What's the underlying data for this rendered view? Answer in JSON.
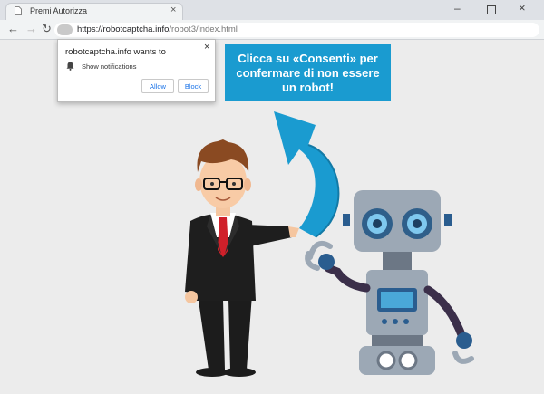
{
  "browser": {
    "tab_title": "Premi Autorizza",
    "tab_close": "×",
    "window_controls": {
      "minimize": "–",
      "close": "×"
    },
    "nav": {
      "back": "←",
      "forward": "→",
      "reload": "↻"
    },
    "url_host": "https://robotcaptcha.info",
    "url_path": "/robot3/index.html"
  },
  "notification_prompt": {
    "title": "robotcaptcha.info wants to",
    "close": "×",
    "permission_icon": "bell-icon",
    "permission_text": "Show notifications",
    "allow_label": "Allow",
    "block_label": "Block"
  },
  "banner": {
    "text": "Clicca su «Consenti» per confermare di non essere un robot!"
  },
  "illustration": {
    "items": [
      "businessman",
      "robot",
      "curved-arrow"
    ],
    "colors": {
      "page_bg": "#ececec",
      "banner_bg": "#1a9bd0",
      "arrow": "#1a9bd0",
      "robot_body": "#9ca8b5",
      "suit": "#1e1e1e",
      "tie": "#d0202a"
    }
  }
}
